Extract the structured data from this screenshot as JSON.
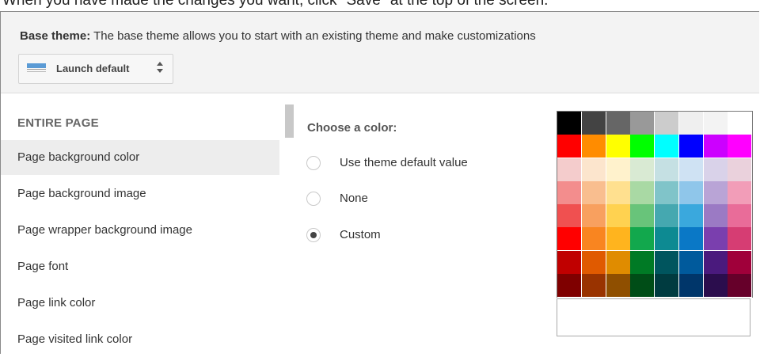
{
  "instruction": "When you have made the changes you want, click \"Save\" at the top of the screen.",
  "header": {
    "base_theme_label": "Base theme:",
    "base_theme_desc": " The base theme allows you to start with an existing theme and make customizations",
    "theme_select_value": "Launch default",
    "theme_select_icon": "theme-thumbnail-icon",
    "theme_select_arrows": "up-down-arrows-icon"
  },
  "sidebar": {
    "section_title": "ENTIRE PAGE",
    "items": [
      {
        "label": "Page background color",
        "selected": true
      },
      {
        "label": "Page background image",
        "selected": false
      },
      {
        "label": "Page wrapper background image",
        "selected": false
      },
      {
        "label": "Page font",
        "selected": false
      },
      {
        "label": "Page link color",
        "selected": false
      },
      {
        "label": "Page visited link color",
        "selected": false
      }
    ]
  },
  "color_panel": {
    "title": "Choose a color:",
    "options": [
      {
        "label": "Use theme default value",
        "checked": false
      },
      {
        "label": "None",
        "checked": false
      },
      {
        "label": "Custom",
        "checked": true
      }
    ],
    "custom_value": "",
    "palette": [
      [
        "#000000",
        "#434343",
        "#666666",
        "#999999",
        "#cccccc",
        "#efefef",
        "#f3f3f3",
        "#ffffff"
      ],
      [
        "#ff0000",
        "#ff8c00",
        "#ffff00",
        "#00ff00",
        "#00ffff",
        "#0000ff",
        "#cc00ff",
        "#ff00ff"
      ],
      [
        "#f4cccc",
        "#fce5cd",
        "#fff2cc",
        "#d9ead3",
        "#c5e0e3",
        "#cfe2f3",
        "#d9d2e9",
        "#ead1dc"
      ],
      [
        "#f38d8d",
        "#f9be8f",
        "#ffe08f",
        "#a9d9a4",
        "#80c4c9",
        "#8fc6ea",
        "#b9a4d6",
        "#f29db8"
      ],
      [
        "#f05050",
        "#f8a05f",
        "#ffd250",
        "#68c47a",
        "#45a8b0",
        "#3aa8dd",
        "#9b7ac4",
        "#e96c99"
      ],
      [
        "#ff0000",
        "#f98520",
        "#ffb41e",
        "#12a84d",
        "#0d8a92",
        "#0a78c6",
        "#7a3fae",
        "#d63d73"
      ],
      [
        "#c00000",
        "#e05a00",
        "#e08c00",
        "#007a25",
        "#00555e",
        "#005a9c",
        "#4a1a7d",
        "#a0003a"
      ],
      [
        "#7f0000",
        "#993300",
        "#8f4f00",
        "#004d17",
        "#003b40",
        "#00366a",
        "#2b0d4d",
        "#66002a"
      ]
    ]
  }
}
